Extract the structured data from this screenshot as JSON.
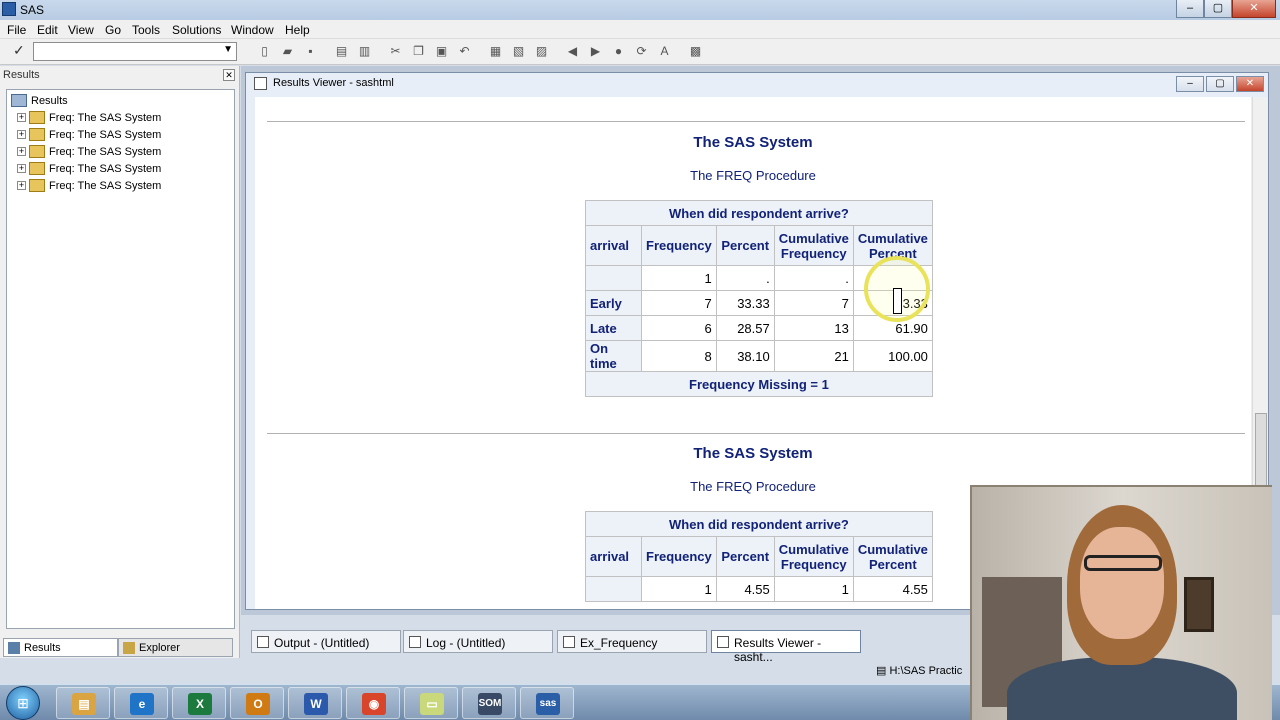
{
  "app": {
    "title": "SAS"
  },
  "menu": [
    "File",
    "Edit",
    "View",
    "Go",
    "Tools",
    "Solutions",
    "Window",
    "Help"
  ],
  "results_pane": {
    "header": "Results",
    "root": "Results",
    "items": [
      {
        "label": "Freq:  The SAS System"
      },
      {
        "label": "Freq:  The SAS System"
      },
      {
        "label": "Freq:  The SAS System"
      },
      {
        "label": "Freq:  The SAS System"
      },
      {
        "label": "Freq:  The SAS System"
      }
    ],
    "tabs": [
      "Results",
      "Explorer"
    ]
  },
  "results_viewer": {
    "title": "Results Viewer - sashtml",
    "tables": [
      {
        "system_title": "The SAS System",
        "procedure": "The FREQ Procedure",
        "caption": "When did respondent arrive?",
        "columns": [
          "arrival",
          "Frequency",
          "Percent",
          "Cumulative Frequency",
          "Cumulative Percent"
        ],
        "col_head": [
          "arrival",
          "Frequency",
          "Percent",
          "Cumulative",
          "Frequency",
          "Cumulative",
          "Percent"
        ],
        "rows": [
          {
            "arrival": "",
            "freq": "1",
            "pct": ".",
            "cfreq": ".",
            "cpct": "."
          },
          {
            "arrival": "Early",
            "freq": "7",
            "pct": "33.33",
            "cfreq": "7",
            "cpct": "33.33"
          },
          {
            "arrival": "Late",
            "freq": "6",
            "pct": "28.57",
            "cfreq": "13",
            "cpct": "61.90"
          },
          {
            "arrival": "On time",
            "freq": "8",
            "pct": "38.10",
            "cfreq": "21",
            "cpct": "100.00"
          }
        ],
        "footer": "Frequency Missing = 1"
      },
      {
        "system_title": "The SAS System",
        "procedure": "The FREQ Procedure",
        "caption": "When did respondent arrive?",
        "col_head": [
          "arrival",
          "Frequency",
          "Percent",
          "Cumulative",
          "Frequency",
          "Cumulative",
          "Percent"
        ],
        "rows": [
          {
            "arrival": "",
            "freq": "1",
            "pct": "4.55",
            "cfreq": "1",
            "cpct": "4.55"
          }
        ]
      }
    ]
  },
  "window_tabs": [
    "Output - (Untitled)",
    "Log - (Untitled)",
    "Ex_Frequency",
    "Results Viewer - sasht..."
  ],
  "status_path": "H:\\SAS Practic",
  "taskbar": {
    "start": "⊞",
    "apps": [
      {
        "name": "explorer",
        "glyph": "▤",
        "color": "#d9a441"
      },
      {
        "name": "internet-explorer",
        "glyph": "e",
        "color": "#1f74c7"
      },
      {
        "name": "excel",
        "glyph": "X",
        "color": "#1d7a3e"
      },
      {
        "name": "outlook",
        "glyph": "O",
        "color": "#d07a13"
      },
      {
        "name": "word",
        "glyph": "W",
        "color": "#2b5aad"
      },
      {
        "name": "chrome",
        "glyph": "◉",
        "color": "#d9452b"
      },
      {
        "name": "folder",
        "glyph": "▭",
        "color": "#c8d87a"
      },
      {
        "name": "som",
        "glyph": "SOM",
        "color": "#394a66"
      },
      {
        "name": "sas",
        "glyph": "sas",
        "color": "#2a5fa8"
      }
    ]
  }
}
